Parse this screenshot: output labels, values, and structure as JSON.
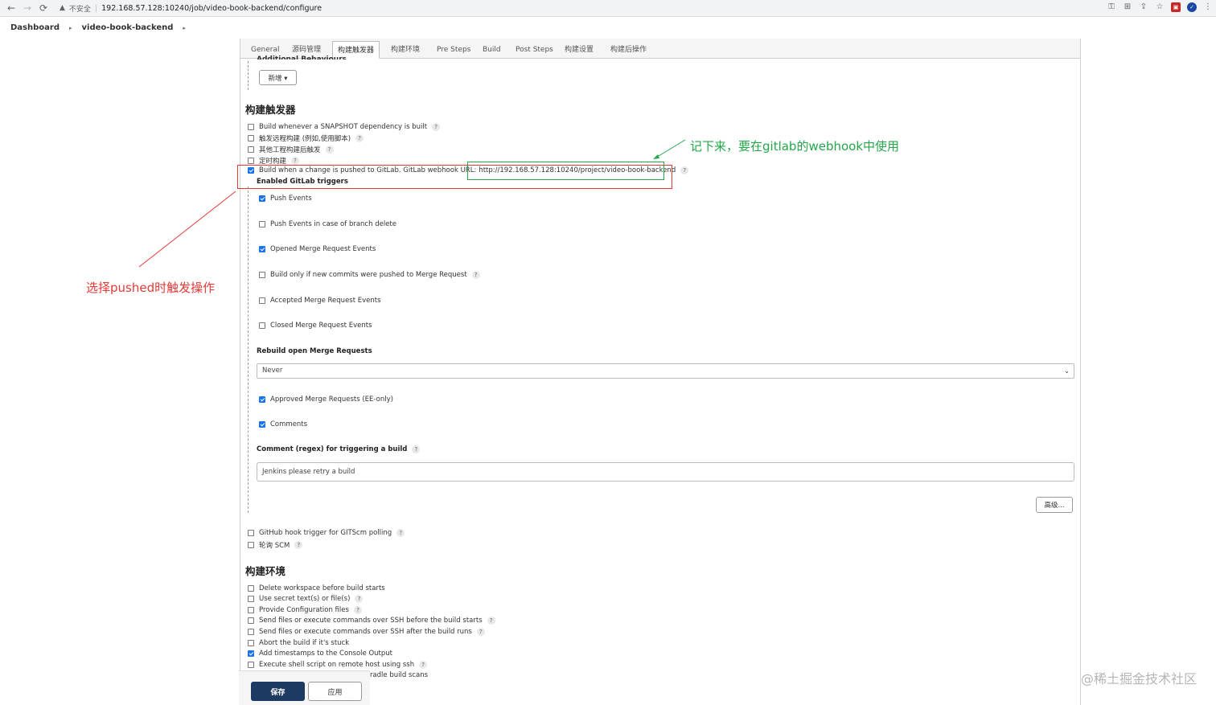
{
  "browser": {
    "back": "←",
    "forward": "→",
    "reload": "⟳",
    "warning_icon": "▲",
    "insecure_label": "不安全",
    "separator": "|",
    "url": "192.168.57.128:10240/job/video-book-backend/configure",
    "icons": [
      "key-icon",
      "translate-icon",
      "share-icon",
      "star-icon",
      "extension-icon",
      "profile-icon",
      "menu-icon"
    ]
  },
  "breadcrumb": {
    "items": [
      "Dashboard",
      "video-book-backend"
    ],
    "separator": "▸"
  },
  "tabs": [
    "General",
    "源码管理",
    "构建触发器",
    "构建环境",
    "Pre Steps",
    "Build",
    "Post Steps",
    "构建设置",
    "构建后操作"
  ],
  "active_tab": "构建触发器",
  "scm": {
    "partial_label": "Additional Behaviours",
    "add_button": "新增 ▾"
  },
  "triggers": {
    "title": "构建触发器",
    "items": [
      {
        "label": "Build whenever a SNAPSHOT dependency is built",
        "checked": false,
        "help": "?"
      },
      {
        "label": "触发远程构建 (例如,使用脚本)",
        "checked": false,
        "help": "?"
      },
      {
        "label": "其他工程构建后触发",
        "checked": false,
        "help": "?"
      },
      {
        "label": "定时构建",
        "checked": false,
        "help": "?"
      },
      {
        "label": "Build when a change is pushed to GitLab. GitLab webhook URL:",
        "url": "http://192.168.57.128:10240/project/video-book-backend",
        "checked": true,
        "help": "?"
      }
    ],
    "gitlab": {
      "title": "Enabled GitLab triggers",
      "options": [
        {
          "label": "Push Events",
          "checked": true
        },
        {
          "label": "Push Events in case of branch delete",
          "checked": false
        },
        {
          "label": "Opened Merge Request Events",
          "checked": true
        },
        {
          "label": "Build only if new commits were pushed to Merge Request",
          "checked": false,
          "help": "?"
        },
        {
          "label": "Accepted Merge Request Events",
          "checked": false
        },
        {
          "label": "Closed Merge Request Events",
          "checked": false
        }
      ],
      "rebuild_label": "Rebuild open Merge Requests",
      "rebuild_value": "Never",
      "approved_label": "Approved Merge Requests (EE-only)",
      "approved_checked": true,
      "comments_label": "Comments",
      "comments_checked": true,
      "comment_regex_label": "Comment (regex) for triggering a build",
      "comment_regex_help": "?",
      "comment_regex_value": "Jenkins please retry a build",
      "advanced_button": "高级..."
    },
    "more": [
      {
        "label": "GitHub hook trigger for GITScm polling",
        "checked": false,
        "help": "?"
      },
      {
        "label": "轮询 SCM",
        "checked": false,
        "help": "?"
      }
    ]
  },
  "build_env": {
    "title": "构建环境",
    "items": [
      {
        "label": "Delete workspace before build starts",
        "checked": false
      },
      {
        "label": "Use secret text(s) or file(s)",
        "checked": false,
        "help": "?"
      },
      {
        "label": "Provide Configuration files",
        "checked": false,
        "help": "?"
      },
      {
        "label": "Send files or execute commands over SSH before the build starts",
        "checked": false,
        "help": "?"
      },
      {
        "label": "Send files or execute commands over SSH after the build runs",
        "checked": false,
        "help": "?"
      },
      {
        "label": "Abort the build if it's stuck",
        "checked": false
      },
      {
        "label": "Add timestamps to the Console Output",
        "checked": true
      },
      {
        "label": "Execute shell script on remote host using ssh",
        "checked": false,
        "help": "?"
      },
      {
        "label": "Inspect build log for published Gradle build scans",
        "checked": false
      }
    ]
  },
  "actions": {
    "save": "保存",
    "apply": "应用"
  },
  "annotations": {
    "green_note": "记下来，要在gitlab的webhook中使用",
    "red_note": "选择pushed时触发操作",
    "green_color": "#22a84a",
    "red_color": "#e53935"
  },
  "watermark": "@稀土掘金技术社区"
}
